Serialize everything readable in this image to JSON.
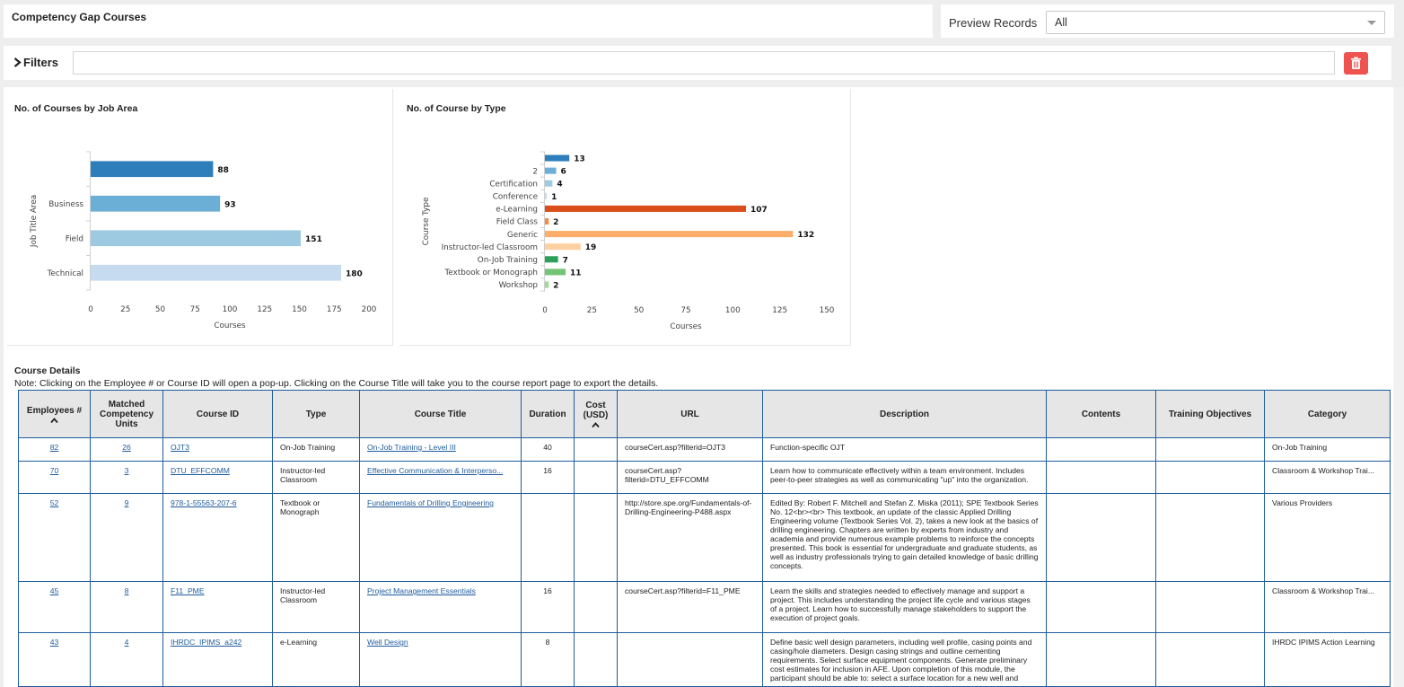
{
  "page": {
    "title": "Competency Gap Courses"
  },
  "preview": {
    "label": "Preview Records",
    "value": "All"
  },
  "filters": {
    "label": "Filters",
    "value": ""
  },
  "colors": {
    "accent": "#1f5c9e",
    "trash": "#ef5350"
  },
  "chart_data": [
    {
      "type": "bar",
      "orientation": "horizontal",
      "title": "No. of Courses by Job Area",
      "xlabel": "Courses",
      "ylabel": "Job Title Area",
      "categories": [
        "",
        "Business",
        "Field",
        "Technical"
      ],
      "values": [
        88,
        93,
        151,
        180
      ],
      "colors": [
        "#2f7ebc",
        "#6baed6",
        "#9ecae1",
        "#c6dbef"
      ],
      "xlim": [
        0,
        200
      ],
      "xticks": [
        0,
        25,
        50,
        75,
        100,
        125,
        150,
        175,
        200
      ]
    },
    {
      "type": "bar",
      "orientation": "horizontal",
      "title": "No. of Course by Type",
      "xlabel": "Courses",
      "ylabel": "Course Type",
      "categories": [
        "",
        "2",
        "Certification",
        "Conference",
        "e-Learning",
        "Field Class",
        "Generic",
        "Instructor-led Classroom",
        "On-Job Training",
        "Textbook or Monograph",
        "Workshop"
      ],
      "values": [
        13,
        6,
        4,
        1,
        107,
        2,
        132,
        19,
        7,
        11,
        2
      ],
      "colors": [
        "#2f7ebc",
        "#6baed6",
        "#9ecae1",
        "#c6dbef",
        "#d94e1a",
        "#f28c48",
        "#fdae6b",
        "#fdd0a2",
        "#2ca05a",
        "#74c476",
        "#a1d99b"
      ],
      "xlim": [
        0,
        150
      ],
      "xticks": [
        0,
        25,
        50,
        75,
        100,
        125,
        150
      ]
    }
  ],
  "details": {
    "heading": "Course Details",
    "note": "Note: Clicking on the Employee # or Course ID will open a pop-up. Clicking on the Course Title will take you to the course report page to export the details.",
    "columns": [
      "Employees #",
      "Matched Competency Units",
      "Course ID",
      "Type",
      "Course Title",
      "Duration",
      "Cost (USD)",
      "URL",
      "Description",
      "Contents",
      "Training Objectives",
      "Category"
    ],
    "rows": [
      {
        "emp": "82",
        "matched": "26",
        "course_id": "OJT3",
        "type": "On-Job Training",
        "title": "On-Job Training - Level III",
        "duration": "40",
        "cost": "",
        "url": "courseCert.asp?filterid=OJT3",
        "description": "Function-specific OJT",
        "contents": "",
        "objectives": "",
        "category": "On-Job Training"
      },
      {
        "emp": "70",
        "matched": "3",
        "course_id": "DTU_EFFCOMM",
        "type": "Instructor-led Classroom",
        "title": "Effective Communication & Interperso...",
        "duration": "16",
        "cost": "",
        "url": "courseCert.asp? filterid=DTU_EFFCOMM",
        "description": "Learn how to communicate effectively within a team environment. Includes peer-to-peer strategies as well as communicating \"up\" into the organization.",
        "contents": "",
        "objectives": "",
        "category": "Classroom & Workshop Trai..."
      },
      {
        "emp": "52",
        "matched": "9",
        "course_id": "978-1-55563-207-6",
        "type": "Textbook or Monograph",
        "title": "Fundamentals of Drilling Engineering",
        "duration": "",
        "cost": "",
        "url": "http://store.spe.org/Fundamentals-of-Drilling-Engineering-P488.aspx",
        "description": "Edited By: Robert F. Mitchell and Stefan Z. Miska (2011); SPE Textbook Series No. 12<br><br> This textbook, an update of the classic Applied Drilling Engineering volume (Textbook Series Vol. 2), takes a new look at the basics of drilling engineering. Chapters are written by experts from industry and academia and provide numerous example problems to reinforce the concepts presented. This book is essential for undergraduate and graduate students, as well as industry professionals trying to gain detailed knowledge of basic drilling concepts.",
        "contents": "",
        "objectives": "",
        "category": "Various Providers"
      },
      {
        "emp": "45",
        "matched": "8",
        "course_id": "F11_PME",
        "type": "Instructor-led Classroom",
        "title": "Project Management Essentials",
        "duration": "16",
        "cost": "",
        "url": "courseCert.asp?filterid=F11_PME",
        "description": "Learn the skills and strategies needed to effectively manage and support a project. This includes understanding the project life cycle and various stages of a project. Learn how to successfully manage stakeholders to support the execution of project goals.",
        "contents": "",
        "objectives": "",
        "category": "Classroom & Workshop Trai..."
      },
      {
        "emp": "43",
        "matched": "4",
        "course_id": "IHRDC_IPIMS_a242",
        "type": "e-Learning",
        "title": "Well Design",
        "duration": "8",
        "cost": "",
        "url": "",
        "description": "Define basic well design parameters, including well profile, casing points and casing/hole diameters. Design casing strings and outline cementing requirements. Select surface equipment components. Generate preliminary cost estimates for inclusion in AFE. Upon completion of this module, the participant should be able to: select a surface location for a new well and",
        "contents": "",
        "objectives": "",
        "category": "IHRDC IPIMS Action Learning"
      }
    ]
  }
}
